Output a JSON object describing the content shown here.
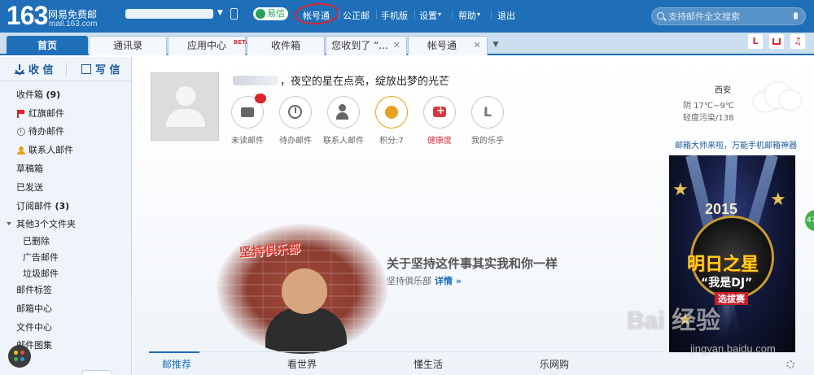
{
  "brand": {
    "logo": "163",
    "name": "网易免费邮",
    "domain": "mail.163.com"
  },
  "topnav": {
    "yixin": "易信",
    "links": [
      "帐号通",
      "公正邮",
      "手机版",
      "设置",
      "帮助",
      "退出"
    ],
    "search_placeholder": "支持邮件全文搜索",
    "accent": "#1e6fb8"
  },
  "tabs": [
    {
      "label": "首页"
    },
    {
      "label": "通讯录"
    },
    {
      "label": "应用中心",
      "badge": "BETA"
    },
    {
      "label": "收件箱"
    },
    {
      "label": "您收到了 “..."
    },
    {
      "label": "帐号通"
    }
  ],
  "app_buttons": [
    "L",
    "",
    "♫"
  ],
  "sidebar": {
    "receive": "收 信",
    "write": "写 信",
    "folders": [
      {
        "label": "收件箱",
        "count": "(9)"
      },
      {
        "label": "红旗邮件"
      },
      {
        "label": "待办邮件"
      },
      {
        "label": "联系人邮件"
      },
      {
        "label": "草稿箱"
      },
      {
        "label": "已发送"
      },
      {
        "label": "订阅邮件",
        "count": "(3)"
      },
      {
        "label": "其他3个文件夹"
      },
      {
        "label": "已删除"
      },
      {
        "label": "广告邮件"
      },
      {
        "label": "垃圾邮件"
      },
      {
        "label": "邮件标签"
      },
      {
        "label": "邮箱中心"
      },
      {
        "label": "文件中心"
      },
      {
        "label": "邮件图集"
      }
    ]
  },
  "main": {
    "greeting": "，夜空的星在点亮，绽放出梦的光芒",
    "quick": [
      {
        "label": "未读邮件",
        "icon": "mail-icon"
      },
      {
        "label": "待办邮件",
        "icon": "clock-icon"
      },
      {
        "label": "联系人邮件",
        "icon": "contact-icon"
      },
      {
        "label": "积分:7",
        "icon": "coin-icon"
      },
      {
        "label": "健康度",
        "icon": "health-icon"
      },
      {
        "label": "我的乐乎",
        "icon": "lofter-icon"
      }
    ],
    "weather": {
      "city": "西安",
      "condition": "阴 17℃~9℃",
      "aqi": "轻度污染/138"
    },
    "promo": "邮箱大师来啦，万能手机邮箱神器",
    "ad": {
      "year": "2015",
      "title": "明日之星",
      "subtitle": "“我是DJ”",
      "tag": "选拔赛"
    },
    "banner": {
      "brand": "坚持俱乐部",
      "title": "关于坚持这件事其实我和你一样",
      "source": "坚持俱乐部",
      "link": "详情 »"
    },
    "bottom_tabs": [
      "邮推荐",
      "看世界",
      "懂生活",
      "乐网购"
    ]
  },
  "watermark": {
    "text": "Bai 经验",
    "url": "jingyan.baidu.com"
  }
}
